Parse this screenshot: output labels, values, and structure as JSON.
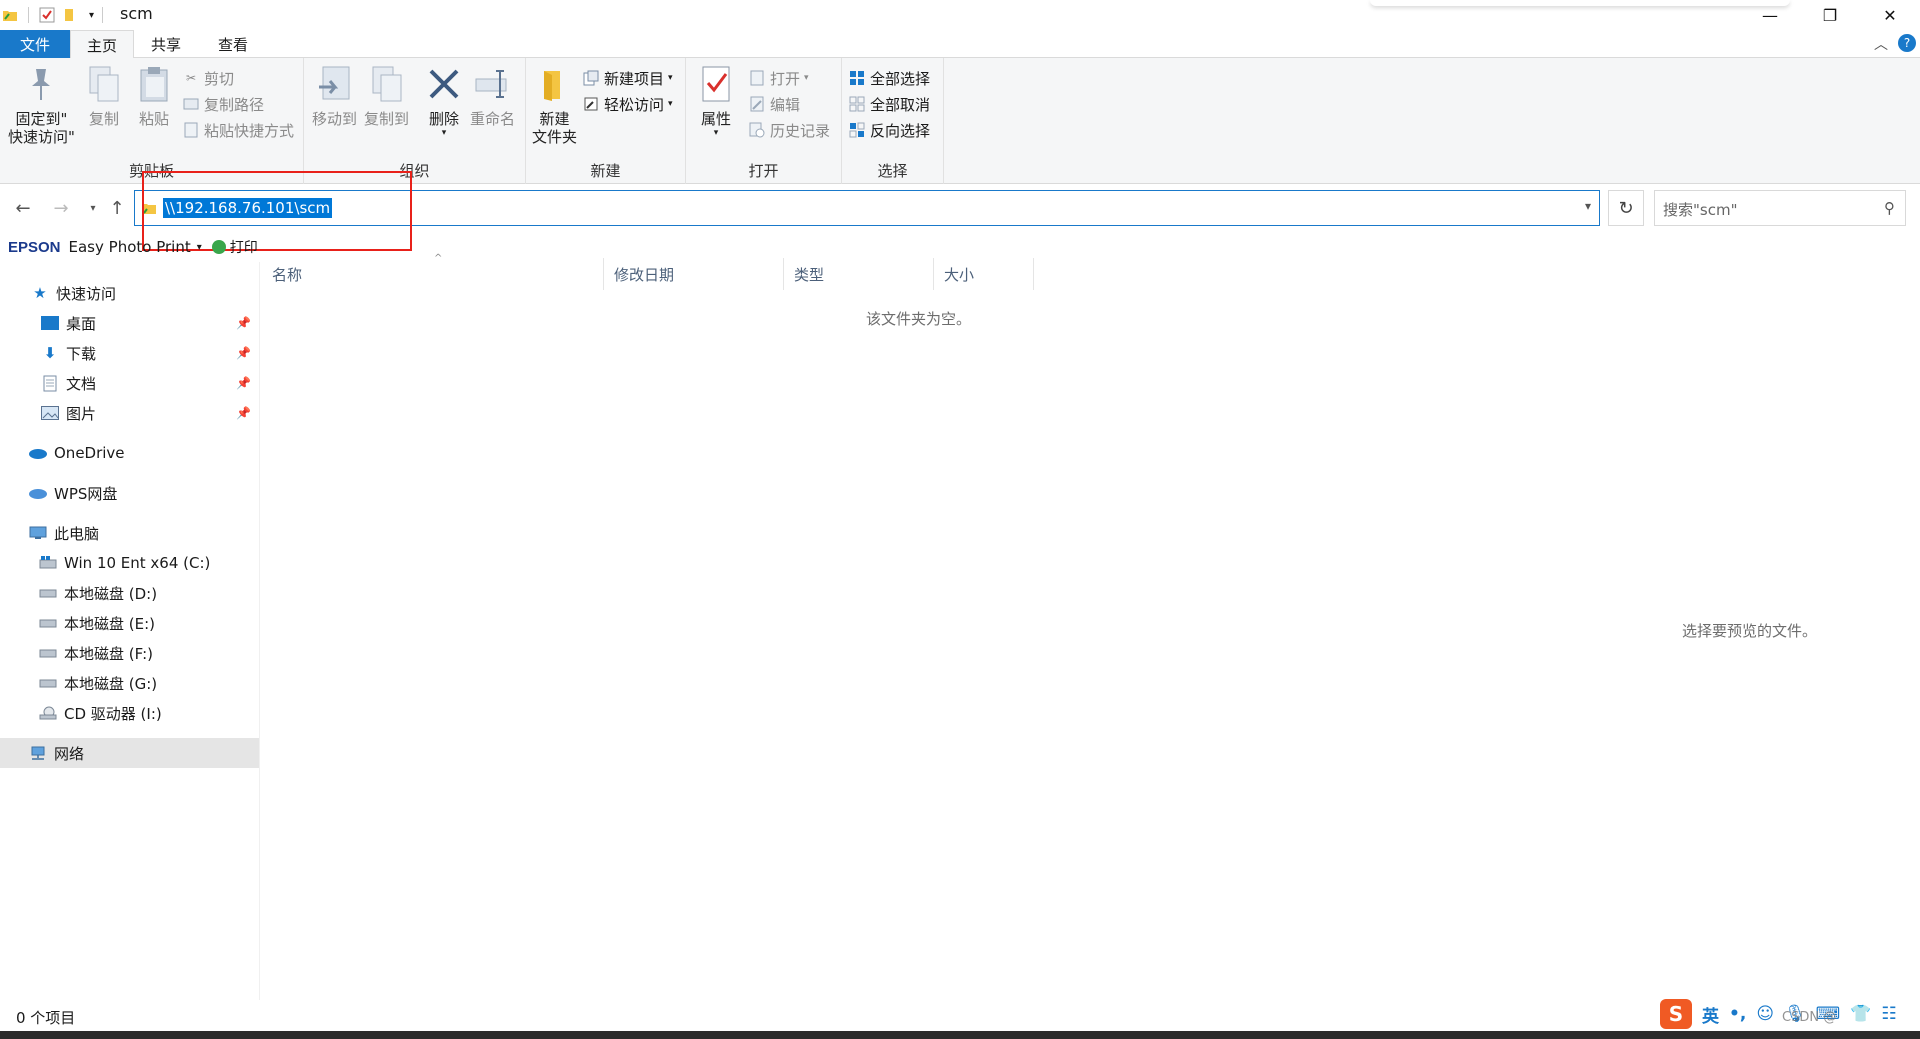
{
  "window": {
    "title": "scm",
    "minimize": "—",
    "restore": "❐",
    "close": "✕"
  },
  "tabs": {
    "file": "文件",
    "home": "主页",
    "share": "共享",
    "view": "查看"
  },
  "ribbon": {
    "clipboard": {
      "label": "剪贴板",
      "pin": "固定到\"快速访问\"",
      "pin_line1": "固定到\"",
      "pin_line2": "快速访问\"",
      "copy": "复制",
      "paste": "粘贴",
      "cut": "剪切",
      "copy_path": "复制路径",
      "paste_shortcut": "粘贴快捷方式"
    },
    "organize": {
      "label": "组织",
      "move_to": "移动到",
      "copy_to": "复制到",
      "delete": "删除",
      "rename": "重命名"
    },
    "new": {
      "label": "新建",
      "new_folder_line1": "新建",
      "new_folder_line2": "文件夹",
      "new_item": "新建项目",
      "easy_access": "轻松访问"
    },
    "open": {
      "label": "打开",
      "properties": "属性",
      "open": "打开",
      "edit": "编辑",
      "history": "历史记录"
    },
    "select": {
      "label": "选择",
      "select_all": "全部选择",
      "select_none": "全部取消",
      "invert": "反向选择"
    }
  },
  "address": {
    "path": "\\\\192.168.76.101\\scm",
    "search_placeholder": "搜索\"scm\""
  },
  "epson": {
    "brand": "EPSON",
    "app": "Easy Photo Print",
    "print": "打印"
  },
  "nav": {
    "quick_access": "快速访问",
    "desktop": "桌面",
    "downloads": "下载",
    "documents": "文档",
    "pictures": "图片",
    "onedrive": "OneDrive",
    "wps": "WPS网盘",
    "this_pc": "此电脑",
    "drive_c": "Win 10 Ent x64 (C:)",
    "drive_d": "本地磁盘 (D:)",
    "drive_e": "本地磁盘 (E:)",
    "drive_f": "本地磁盘 (F:)",
    "drive_g": "本地磁盘 (G:)",
    "drive_i": "CD 驱动器 (I:)",
    "network": "网络"
  },
  "columns": {
    "name": "名称",
    "modified": "修改日期",
    "type": "类型",
    "size": "大小"
  },
  "content": {
    "empty": "该文件夹为空。",
    "preview": "选择要预览的文件。"
  },
  "status": {
    "items": "0 个项目"
  },
  "ime": {
    "lang": "英",
    "punct": "•,"
  },
  "watermark": "CSDN @"
}
